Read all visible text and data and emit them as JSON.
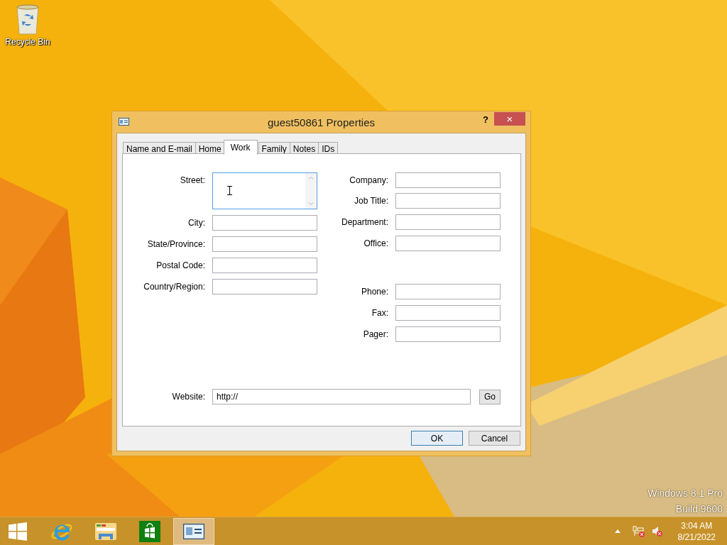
{
  "desktop": {
    "icons": [
      {
        "label": "Recycle Bin"
      }
    ],
    "watermark": [
      "Windows 8.1 Pro",
      "Build 9600"
    ]
  },
  "dialog": {
    "title": "guest50861 Properties",
    "help": "?",
    "close": "×",
    "tabs": [
      {
        "label": "Name and E-mail",
        "selected": false
      },
      {
        "label": "Home",
        "selected": false
      },
      {
        "label": "Work",
        "selected": true
      },
      {
        "label": "Family",
        "selected": false
      },
      {
        "label": "Notes",
        "selected": false
      },
      {
        "label": "IDs",
        "selected": false
      }
    ],
    "address_fields": [
      {
        "label": "Street:",
        "kind": "multiline",
        "focused": true
      },
      {
        "label": "City:",
        "kind": "text",
        "focused": false
      },
      {
        "label": "State/Province:",
        "kind": "text",
        "focused": false
      },
      {
        "label": "Postal Code:",
        "kind": "text",
        "focused": false
      },
      {
        "label": "Country/Region:",
        "kind": "text",
        "focused": false
      }
    ],
    "company_fields": [
      {
        "label": "Company:"
      },
      {
        "label": "Job Title:"
      },
      {
        "label": "Department:"
      },
      {
        "label": "Office:"
      }
    ],
    "phone_fields": [
      {
        "label": "Phone:"
      },
      {
        "label": "Fax:"
      },
      {
        "label": "Pager:"
      }
    ],
    "website": {
      "label": "Website:",
      "value": "http://",
      "button": "Go"
    },
    "buttons": [
      {
        "label": "OK",
        "default": true
      },
      {
        "label": "Cancel",
        "default": false
      }
    ]
  },
  "taskbar": {
    "apps": [
      {
        "kind": "start",
        "active": false
      },
      {
        "kind": "browser",
        "active": false
      },
      {
        "kind": "folder",
        "active": false
      },
      {
        "kind": "store",
        "active": false
      },
      {
        "kind": "contact",
        "active": true
      }
    ],
    "clock": {
      "time": "3:04 AM",
      "date": "8/21/2022"
    }
  }
}
